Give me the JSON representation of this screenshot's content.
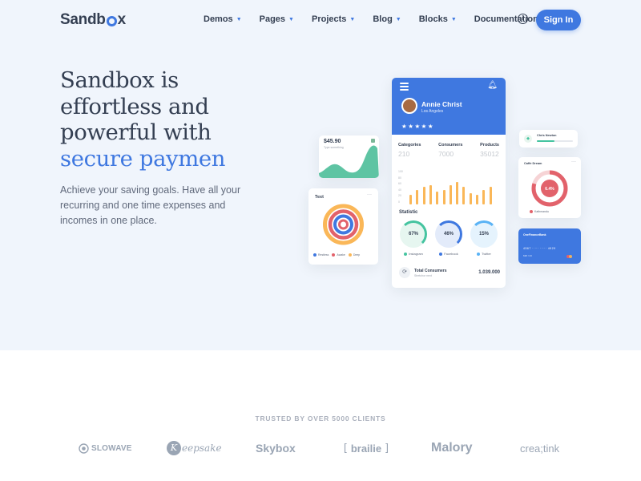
{
  "brand": {
    "logo_text_1": "Sandb",
    "logo_text_2": "x",
    "accent": "#3f78e0"
  },
  "nav": {
    "items": [
      {
        "label": "Demos"
      },
      {
        "label": "Pages"
      },
      {
        "label": "Projects"
      },
      {
        "label": "Blog"
      },
      {
        "label": "Blocks"
      },
      {
        "label": "Documentation"
      }
    ],
    "signin_label": "Sign In"
  },
  "hero": {
    "headline_line1": "Sandbox is",
    "headline_line2": "effortless and",
    "headline_line3": "powerful with",
    "headline_highlight": "secure paymen",
    "lead": "Achieve your saving goals. Have all your recurring and one time expenses and incomes in one place."
  },
  "phone": {
    "name": "Annie Christ",
    "city": "Los Angeles",
    "stars": "★★★★★",
    "stats": [
      {
        "label": "Categories",
        "value": "210"
      },
      {
        "label": "Consumers",
        "value": "7000"
      },
      {
        "label": "Products",
        "value": "35012"
      }
    ],
    "bar_axis": [
      "100",
      "80",
      "60",
      "40",
      "20",
      "0"
    ],
    "bar_values": [
      30,
      45,
      55,
      60,
      40,
      45,
      60,
      70,
      55,
      35,
      30,
      45,
      55
    ],
    "statistic_title": "Statistic",
    "rings": [
      {
        "value": "67%",
        "label": "Instagram",
        "color": "#45c4a0"
      },
      {
        "value": "46%",
        "label": "Facebook",
        "color": "#3f78e0"
      },
      {
        "value": "15%",
        "label": "Twitter",
        "color": "#5ab3f5"
      }
    ],
    "total_title": "Total Consumers",
    "total_sub": "Stretchor next",
    "total_value": "1.039.000"
  },
  "balance_card": {
    "amount": "$45.90",
    "subtitle": "Type something"
  },
  "text_card": {
    "title": "Text",
    "more": "···",
    "legend": [
      {
        "label": "Restless",
        "color": "#3f78e0"
      },
      {
        "label": "Awake",
        "color": "#e2626b"
      },
      {
        "label": "Deep",
        "color": "#fab758"
      }
    ]
  },
  "chris_card": {
    "name": "Chris Newton"
  },
  "cafe_card": {
    "title": "Caffe Dream",
    "more": "···",
    "value": "6.4%",
    "legend": "Kathmandu"
  },
  "bank_card": {
    "name": "OneFinanceBank",
    "number": "4567   ·····   ·····   4929",
    "expiry": "MM / 23"
  },
  "clients": {
    "trusted_label": "TRUSTED BY OVER 5000 CLIENTS",
    "logos": [
      {
        "name": "SLOWAVE"
      },
      {
        "name": "eepsake",
        "initial": "K"
      },
      {
        "name": "Skybox"
      },
      {
        "name": "brailie"
      },
      {
        "name": "Malory"
      },
      {
        "name": "crea;tink"
      }
    ]
  }
}
